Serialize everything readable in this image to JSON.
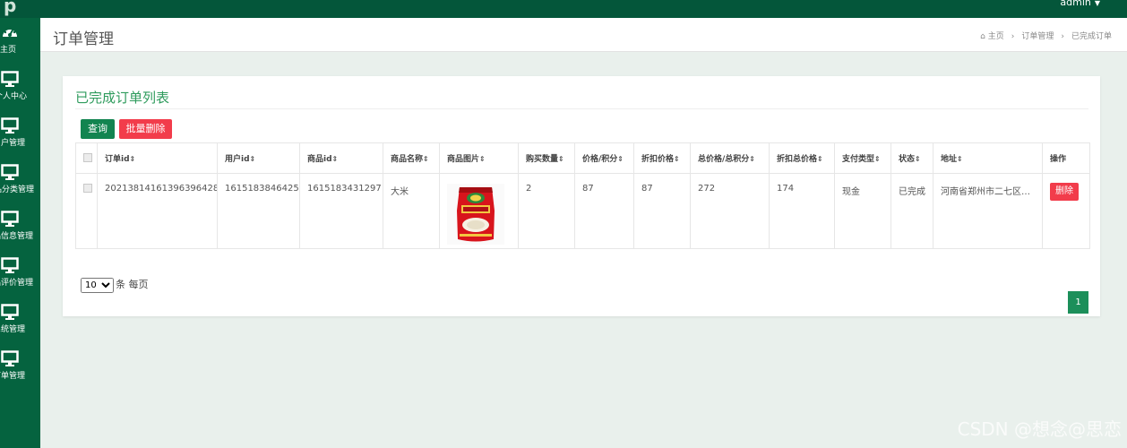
{
  "topbar": {
    "logo": "p",
    "user": "admin"
  },
  "sidebar": {
    "items": [
      {
        "label": "主页",
        "icon": "dashboard-icon"
      },
      {
        "label": "个人中心",
        "icon": "monitor-icon"
      },
      {
        "label": "用户管理",
        "icon": "monitor-icon"
      },
      {
        "label": "商品分类管理",
        "icon": "monitor-icon"
      },
      {
        "label": "商品信息管理",
        "icon": "monitor-icon"
      },
      {
        "label": "商品评价管理",
        "icon": "monitor-icon"
      },
      {
        "label": "系统管理",
        "icon": "monitor-icon"
      },
      {
        "label": "订单管理",
        "icon": "monitor-icon"
      }
    ]
  },
  "header": {
    "title": "订单管理",
    "breadcrumb": [
      "主页",
      "订单管理",
      "已完成订单"
    ],
    "breadcrumb_sep": "›"
  },
  "panel": {
    "title": "已完成订单列表",
    "query_button": "查询",
    "batch_delete_button": "批量删除"
  },
  "table": {
    "columns": [
      "订单id",
      "用户id",
      "商品id",
      "商品名称",
      "商品图片",
      "购买数量",
      "价格/积分",
      "折扣价格",
      "总价格/总积分",
      "折扣总价格",
      "支付类型",
      "状态",
      "地址",
      "操作"
    ],
    "sort_glyph": "⇕",
    "rows": [
      {
        "order_id": "20213814161396396428",
        "user_id": "1615183846425",
        "product_id": "1615183431297",
        "product_name": "大米",
        "product_image": "rice-bag-image",
        "quantity": "2",
        "price": "87",
        "discount_price": "87",
        "total_price": "272",
        "discount_total": "174",
        "pay_type": "现金",
        "status": "已完成",
        "address": "河南省郑州市二七区解...",
        "action": "删除"
      }
    ]
  },
  "pagination": {
    "page_size": "10",
    "per_page_label": "条 每页",
    "current_page": "1"
  },
  "watermark": "CSDN @想念@思恋",
  "colors": {
    "sidebar": "#05633f",
    "topbar": "#04563a",
    "accent": "#2e9b5c",
    "danger": "#f23c4b",
    "primary": "#128450"
  }
}
